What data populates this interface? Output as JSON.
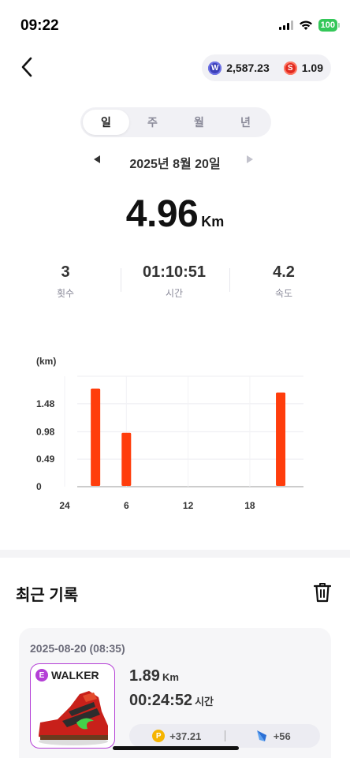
{
  "status_bar": {
    "time": "09:22",
    "battery": "100"
  },
  "header": {
    "balance_w": "2,587.23",
    "balance_s": "1.09",
    "icons": [
      "back-chevron-icon",
      "w-coin-icon",
      "s-coin-icon"
    ]
  },
  "period_tabs": [
    {
      "label": "일",
      "active": true
    },
    {
      "label": "주",
      "active": false
    },
    {
      "label": "월",
      "active": false
    },
    {
      "label": "년",
      "active": false
    }
  ],
  "date_nav": {
    "date": "2025년 8월 20일"
  },
  "summary": {
    "distance": "4.96",
    "distance_unit": "Km",
    "stats": [
      {
        "value": "3",
        "label": "횟수"
      },
      {
        "value": "01:10:51",
        "label": "시간"
      },
      {
        "value": "4.2",
        "label": "속도"
      }
    ]
  },
  "chart_data": {
    "type": "bar",
    "ylabel": "(km)",
    "yticks": [
      "0",
      "0.49",
      "0.98",
      "1.48"
    ],
    "xticks": [
      "24",
      "6",
      "12",
      "18"
    ],
    "ylim": [
      0,
      1.97
    ],
    "x_label_hours": [
      0,
      6,
      12,
      18
    ],
    "bars": [
      {
        "hour": 3,
        "value": 1.75
      },
      {
        "hour": 6,
        "value": 0.96
      },
      {
        "hour": 21,
        "value": 1.68
      }
    ],
    "color": "#ff3d0c",
    "grid": true
  },
  "records": {
    "title": "최근 기록",
    "items": [
      {
        "date": "2025-08-20 (08:35)",
        "shoe_badge": "E",
        "shoe_name": "WALKER",
        "distance": "1.89",
        "distance_unit": "Km",
        "time": "00:24:52",
        "time_unit": "시간",
        "reward_p": "+37.21",
        "reward_gem": "+56"
      }
    ]
  },
  "colors": {
    "accent": "#ff3d0c",
    "shoe_frame": "#b43fd6"
  }
}
